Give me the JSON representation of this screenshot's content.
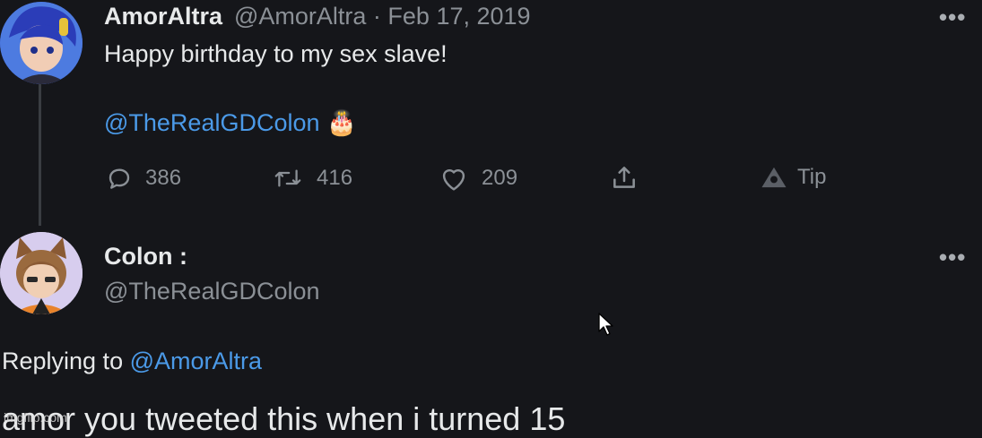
{
  "tweet": {
    "author_name": "AmorAltra",
    "handle_date": "@AmorAltra · Feb 17, 2019",
    "text": "Happy birthday to my sex slave!",
    "mention": "@TheRealGDColon",
    "emoji": "🎂",
    "more": "•••",
    "actions": {
      "reply_count": "386",
      "retweet_count": "416",
      "like_count": "209",
      "tip_label": "Tip"
    }
  },
  "reply": {
    "author_name": "Colon :",
    "handle": "@TheRealGDColon",
    "more": "•••",
    "replying_prefix": "Replying to",
    "replying_handle": "@AmorAltra",
    "text": "amor you tweeted this when i turned 15"
  },
  "watermark": "imgflip.com",
  "colors": {
    "background": "#15161a",
    "link": "#4b9ae8",
    "muted": "#8b9096"
  }
}
